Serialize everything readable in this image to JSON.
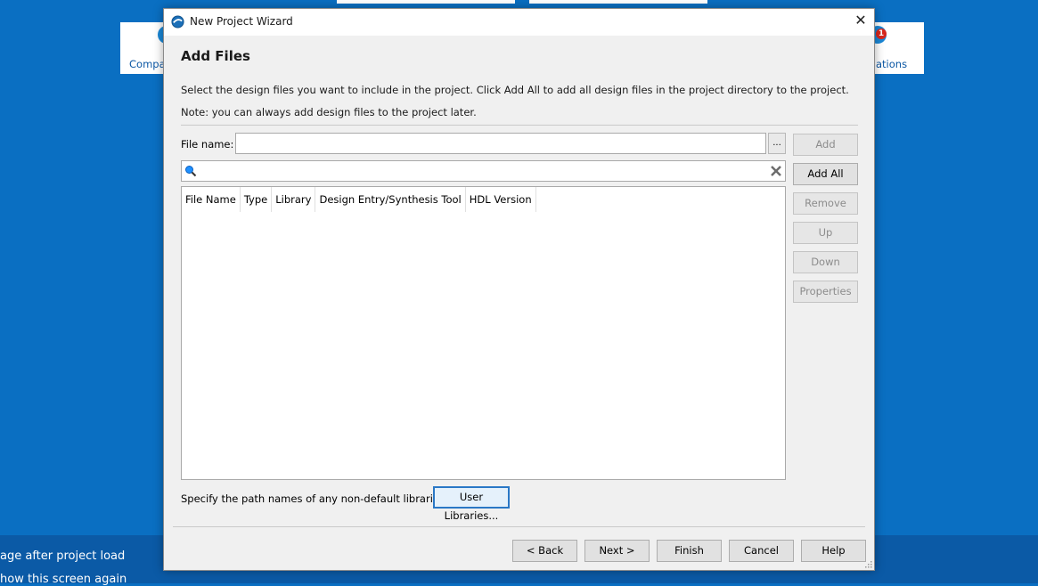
{
  "background": {
    "cards": [
      {
        "label": "Compa"
      },
      {
        "label": "ations",
        "badge": "1"
      }
    ],
    "bottom_lines": [
      "age after project load",
      "how this screen again"
    ]
  },
  "dialog": {
    "title": "New Project Wizard",
    "close_symbol": "✕",
    "heading": "Add Files",
    "description": "Select the design files you want to include in the project. Click Add All to add all design files in the project directory to the project.",
    "note": "Note: you can always add design files to the project later.",
    "file_name_label": "File name:",
    "file_name_value": "",
    "browse_label": "...",
    "search_value": "",
    "side_buttons": {
      "add": "Add",
      "add_all": "Add All",
      "remove": "Remove",
      "up": "Up",
      "down": "Down",
      "properties": "Properties"
    },
    "table": {
      "columns": [
        "File Name",
        "Type",
        "Library",
        "Design Entry/Synthesis Tool",
        "HDL Version"
      ],
      "rows": []
    },
    "libraries_text": "Specify the path names of any non-default libraries.",
    "user_libraries_button": "User Libraries...",
    "footer_buttons": {
      "back": "< Back",
      "next": "Next >",
      "finish": "Finish",
      "cancel": "Cancel",
      "help": "Help"
    }
  },
  "colors": {
    "desktop": "#0a6fc2",
    "dialog_bg": "#f0f0f0",
    "focus_border": "#2a78c6"
  }
}
